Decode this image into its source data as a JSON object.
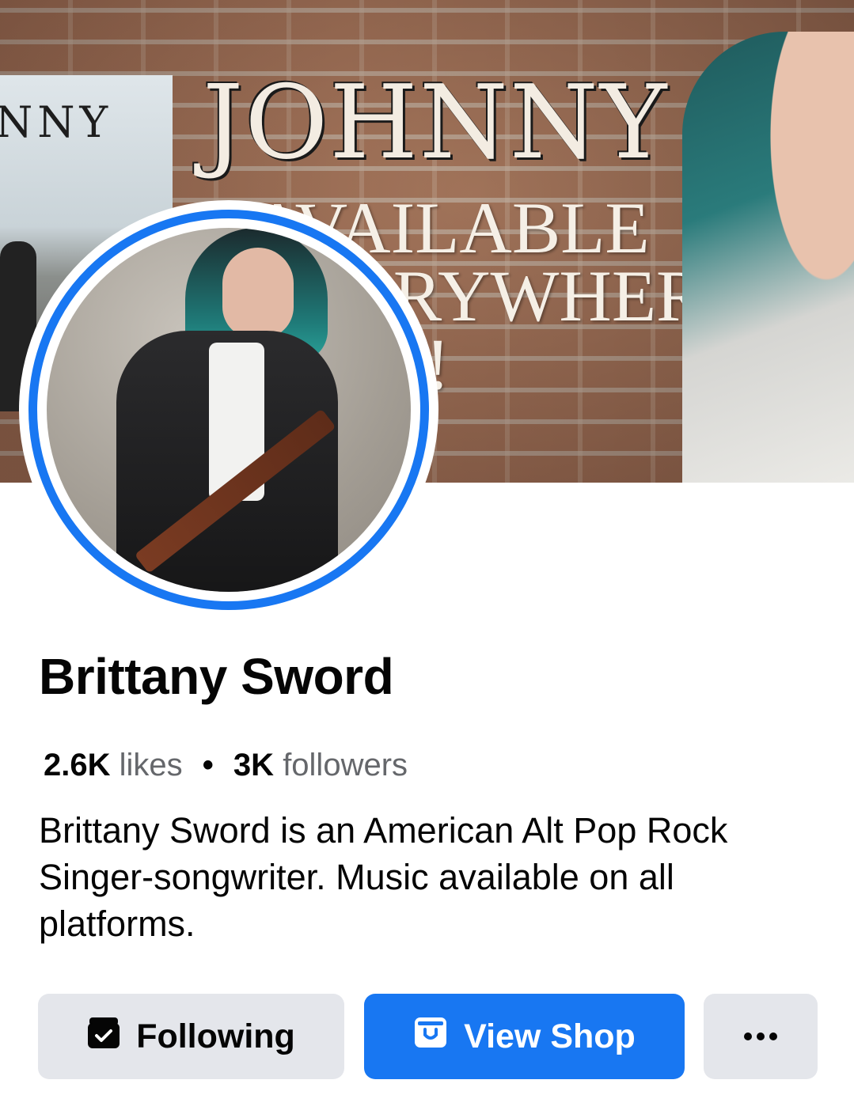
{
  "cover": {
    "title": "JOHNNY",
    "tagline": "AVAILABLE\nEVERYWHERE\nNOW!",
    "thumb_title": "NNY"
  },
  "profile": {
    "name": "Brittany Sword",
    "likes_count": "2.6K",
    "likes_label": "likes",
    "separator": "•",
    "followers_count": "3K",
    "followers_label": "followers",
    "bio": "Brittany Sword is an American Alt Pop Rock Singer-songwriter. Music available on all platforms."
  },
  "actions": {
    "following_label": "Following",
    "shop_label": "View Shop",
    "more_icon": "more-options-icon"
  },
  "colors": {
    "accent": "#1877f2",
    "button_gray": "#e4e6eb",
    "muted_text": "#65676b"
  }
}
